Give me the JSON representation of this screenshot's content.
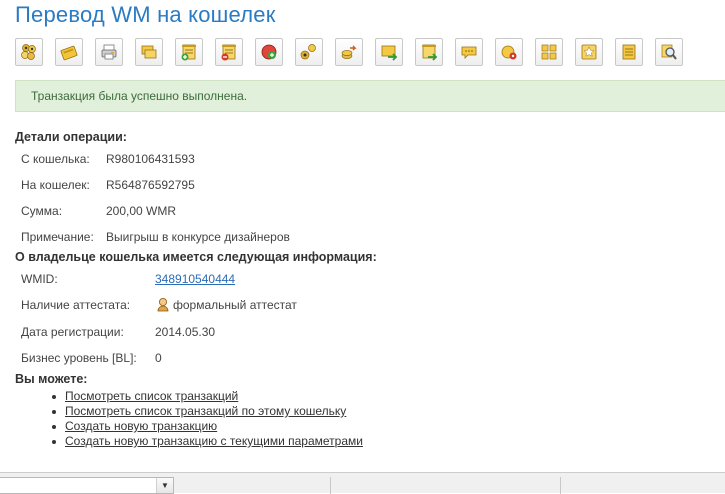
{
  "page": {
    "title": "Перевод WM на кошелек"
  },
  "toolbar": {
    "buttons": [
      {
        "name": "users-icon"
      },
      {
        "name": "wallet-icon"
      },
      {
        "name": "printer-icon"
      },
      {
        "name": "cards-icon"
      },
      {
        "name": "add-invoice-icon"
      },
      {
        "name": "remove-invoice-icon"
      },
      {
        "name": "add-circle-icon"
      },
      {
        "name": "user-coins-icon"
      },
      {
        "name": "coins-transfer-icon"
      },
      {
        "name": "envelope-arrow-icon"
      },
      {
        "name": "document-arrow-icon"
      },
      {
        "name": "message-icon"
      },
      {
        "name": "coin-settings-icon"
      },
      {
        "name": "grid-icon"
      },
      {
        "name": "star-icon"
      },
      {
        "name": "list-icon"
      },
      {
        "name": "search-icon"
      }
    ]
  },
  "alert": {
    "text": "Транзакция была успешно выполнена."
  },
  "operation": {
    "title": "Детали операции:",
    "from_label": "С кошелька:",
    "from_value": "R980106431593",
    "to_label": "На кошелек:",
    "to_value": "R564876592795",
    "amount_label": "Сумма:",
    "amount_value": "200,00 WMR",
    "note_label": "Примечание:",
    "note_value": "Выигрыш в конкурсе дизайнеров"
  },
  "owner": {
    "title": "О владельце кошелька имеется следующая информация:",
    "wmid_label": "WMID:",
    "wmid_value": "348910540444",
    "cert_label": "Наличие аттестата:",
    "cert_value": "формальный аттестат",
    "reg_label": "Дата регистрации:",
    "reg_value": "2014.05.30",
    "bl_label": "Бизнес уровень [BL]:",
    "bl_value": "0"
  },
  "actions": {
    "title": "Вы можете:",
    "items": [
      "Посмотреть список транзакций",
      "Посмотреть список транзакций по этому кошельку",
      "Создать новую транзакцию",
      "Создать новую транзакцию с текущими параметрами"
    ]
  },
  "colors": {
    "title": "#2b7bc3",
    "alert_bg": "#e1f0da",
    "link": "#2b6cb6"
  }
}
